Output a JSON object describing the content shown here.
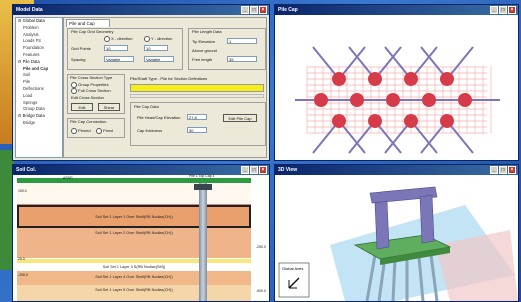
{
  "windows": {
    "main_title": "Model Data",
    "pile_cap_title": "Pile Cap",
    "soil_title": "Soil Col.",
    "view3d_title": "3D View"
  },
  "buttons": {
    "minimize": "_",
    "maximize": "□",
    "close": "×"
  },
  "tree": {
    "items": [
      {
        "label": "Global Data",
        "level": 0
      },
      {
        "label": "Problem",
        "level": 1
      },
      {
        "label": "Analysis",
        "level": 1
      },
      {
        "label": "Loads FS",
        "level": 1
      },
      {
        "label": "Foundation",
        "level": 1
      },
      {
        "label": "Features",
        "level": 1
      },
      {
        "label": "Pile Data",
        "level": 0
      },
      {
        "label": "Pile and Cap",
        "level": 1,
        "selected": true
      },
      {
        "label": "Soil",
        "level": 1
      },
      {
        "label": "Pile",
        "level": 1
      },
      {
        "label": "Deflections",
        "level": 1
      },
      {
        "label": "Load",
        "level": 1
      },
      {
        "label": "Springs",
        "level": 1
      },
      {
        "label": "Group Data",
        "level": 1
      },
      {
        "label": "Bridge Data",
        "level": 0
      },
      {
        "label": "Bridge",
        "level": 1
      }
    ]
  },
  "form": {
    "tab": "Pile and Cap",
    "cap_geometry": {
      "title": "Pile Cap Grid Geometry",
      "x_dir": "X - direction",
      "y_dir": "Y - direction",
      "grid_points": "Grid Points",
      "grid_points_x": "10",
      "grid_points_y": "10",
      "spacing": "Spacing",
      "spacing_x": "Variable",
      "spacing_y": "Variable"
    },
    "pile_length": {
      "title": "Pile Length Data",
      "tip_elevation": "Tip Elevation",
      "tip_value": "1",
      "above_ground": "Above ground",
      "free_length": "Free length",
      "free_value": "35"
    },
    "cross_section": {
      "title": "Pile Cross Section Type",
      "opt1": "Group Properties",
      "opt2": "Full Cross Section",
      "edit_label": "Edit Cross Section",
      "edit_button": "Edit",
      "shear": "Shear"
    },
    "connection": {
      "title": "Pile Cap Connection",
      "opt1": "Pinned",
      "opt2": "Fixed"
    },
    "shell_type": "Pile/Shaft Type - Pile for Section Definitions",
    "pile_cap_data": {
      "title": "Pile Cap Data",
      "bottom_elevation": "Pile Head/Cap Elevation",
      "bottom_value": "27.8",
      "thickness": "Cap thickness",
      "thickness_value": "30",
      "edit_button": "Edit Pile Cap"
    }
  },
  "soil": {
    "header_left": "ASDP",
    "header_mid": "Pile 1 Top Cap 1",
    "layers": [
      "Soil Set 1 Layer 1 Over Shell(RB Nodiax(CH))",
      "Soil Set 1 Layer 2 Over Shell(RB Nodiax(CH))",
      "Soil Set 1 Layer 3 S(RB Nodiax(SM))",
      "Soil Set 1 Layer 4 Over Shell(RB Nodiax(CH))",
      "Soil Set 1 Layer 5 Over Shell(RB Nodiax(CH))"
    ],
    "elev_labels": [
      "-250.0",
      "-500.0"
    ],
    "left_labels": [
      "100.0",
      "20.0",
      "-200.0"
    ]
  },
  "view3d": {
    "global_axes": "Global Axes"
  },
  "colors": {
    "titlebar": "#0a246a",
    "pile_marker": "#d63b4a",
    "pile_leg": "#7a76b8",
    "soil_orange": "#e9a06c",
    "cap_green": "#5fae5f"
  }
}
